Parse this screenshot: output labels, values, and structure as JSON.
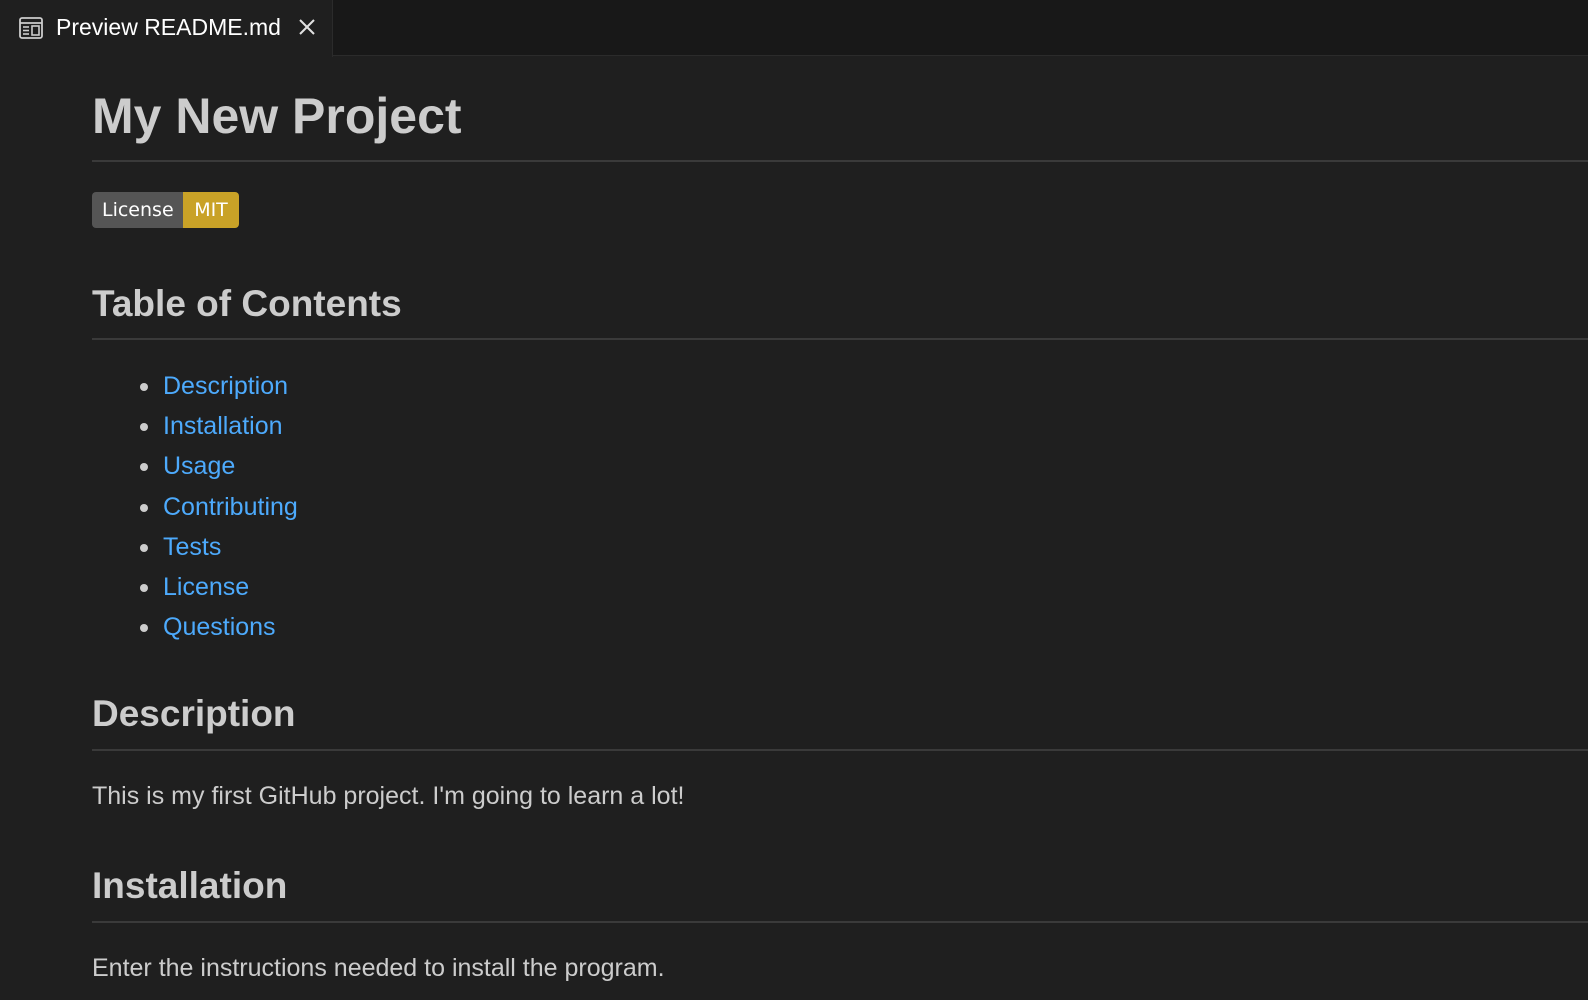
{
  "tab": {
    "title": "Preview README.md",
    "icon": "preview-icon",
    "close_icon": "close-icon"
  },
  "document": {
    "title": "My New Project",
    "badge": {
      "label": "License",
      "value": "MIT",
      "value_color": "#c9a227"
    },
    "toc": {
      "heading": "Table of Contents",
      "items": [
        "Description",
        "Installation",
        "Usage",
        "Contributing",
        "Tests",
        "License",
        "Questions"
      ]
    },
    "description": {
      "heading": "Description",
      "text": "This is my first GitHub project. I'm going to learn a lot!"
    },
    "installation": {
      "heading": "Installation",
      "text": "Enter the instructions needed to install the program."
    }
  },
  "colors": {
    "background": "#1f1f1f",
    "tabbar": "#181818",
    "link": "#4daafc",
    "text": "#cccccc"
  }
}
